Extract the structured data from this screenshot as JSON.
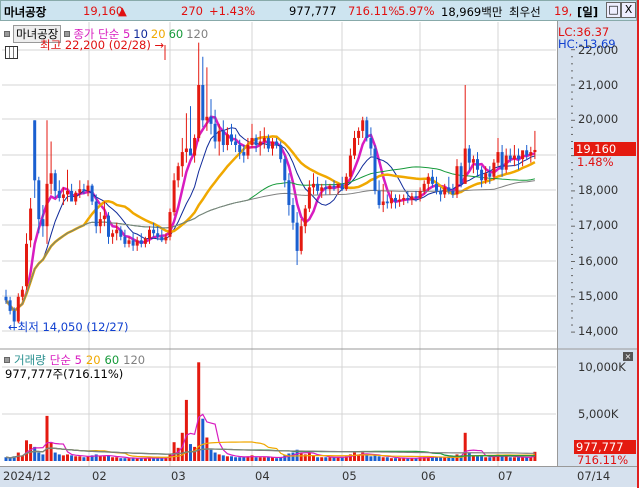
{
  "header": {
    "name": "마녀공장",
    "price": "19,160",
    "arrow": "▲",
    "change": "270",
    "change_pct": "+1.43%",
    "volume": "977,777",
    "volume_ratio": "716.11%",
    "turnover": "5.97%",
    "amount": "18,969백만",
    "best_label": "최우선",
    "best_price": "19,",
    "period": "[일]",
    "restore": "□",
    "close": "X"
  },
  "legend": {
    "stock_button": "마녀공장",
    "ma_label": "종가 단순 5",
    "ma10": "10",
    "ma20": "20",
    "ma60": "60",
    "ma120": "120"
  },
  "volume_legend": {
    "label": "거래량",
    "simple": "단순 5",
    "ma20": "20",
    "ma60": "60",
    "ma120": "120",
    "readout": "977,777주(716.11%)"
  },
  "annotations": {
    "high": "최고 22,200 (02/28)",
    "high_arrow": "→",
    "low": "최저 14,050 (12/27)",
    "low_arrow": "←"
  },
  "axis": {
    "lc": "LC:36.37",
    "hc": "HC:-13.69",
    "price_ticks": [
      "22,000",
      "21,000",
      "20,000",
      "18,000",
      "17,000",
      "16,000",
      "15,000",
      "14,000"
    ],
    "current_price": "19,160",
    "current_pct": "1.48%",
    "volume_ticks": [
      "10,000K",
      "5,000K"
    ],
    "current_volume": "977,777",
    "current_volume_pct": "716.11%"
  },
  "dates": [
    "2024/12",
    "02",
    "03",
    "04",
    "05",
    "06",
    "07",
    "07/14"
  ],
  "colors": {
    "up": "#e41a10",
    "down": "#1a5fd0",
    "ma5": "#d81cc0",
    "ma10": "#102a9a",
    "ma20": "#f0a800",
    "ma60": "#169a3a",
    "ma120": "#808080"
  },
  "chart_data": {
    "type": "candlestick",
    "price_range": [
      13700,
      22300
    ],
    "volume_range_k": [
      0,
      10500
    ],
    "ma_periods": [
      5,
      10,
      20,
      60,
      120
    ],
    "ohlcv": [
      [
        15000,
        15200,
        14800,
        14900,
        400
      ],
      [
        14900,
        15000,
        14500,
        14600,
        300
      ],
      [
        14600,
        14700,
        14050,
        14300,
        500
      ],
      [
        14300,
        15100,
        14250,
        15000,
        900
      ],
      [
        15000,
        15300,
        14900,
        15200,
        600
      ],
      [
        15300,
        16800,
        15200,
        16500,
        2200
      ],
      [
        16600,
        17800,
        16400,
        17500,
        1800
      ],
      [
        20000,
        20000,
        17800,
        18300,
        1500
      ],
      [
        18300,
        18400,
        16800,
        17200,
        900
      ],
      [
        17200,
        17600,
        16700,
        17000,
        700
      ],
      [
        17000,
        20000,
        16500,
        18200,
        4800
      ],
      [
        18200,
        19400,
        17900,
        18500,
        2000
      ],
      [
        18500,
        18600,
        17800,
        18000,
        900
      ],
      [
        18000,
        18300,
        17700,
        17800,
        700
      ],
      [
        17800,
        18100,
        17600,
        17900,
        600
      ],
      [
        17900,
        18600,
        17700,
        18000,
        700
      ],
      [
        18000,
        18200,
        17700,
        17700,
        600
      ],
      [
        17700,
        18000,
        17600,
        17950,
        500
      ],
      [
        17950,
        18300,
        17800,
        18050,
        500
      ],
      [
        18050,
        18200,
        17900,
        18000,
        400
      ],
      [
        18000,
        18300,
        17850,
        18150,
        500
      ],
      [
        18150,
        18200,
        17600,
        17700,
        600
      ],
      [
        17700,
        17900,
        16800,
        17000,
        700
      ],
      [
        17000,
        17400,
        16800,
        17200,
        500
      ],
      [
        17200,
        17700,
        17000,
        17300,
        500
      ],
      [
        17300,
        17400,
        16500,
        16700,
        600
      ],
      [
        16700,
        16900,
        16500,
        16800,
        400
      ],
      [
        16800,
        17100,
        16600,
        16900,
        400
      ],
      [
        16900,
        17000,
        16600,
        16700,
        300
      ],
      [
        16700,
        16900,
        16400,
        16500,
        300
      ],
      [
        16500,
        16700,
        16400,
        16600,
        300
      ],
      [
        16600,
        16800,
        16300,
        16450,
        300
      ],
      [
        16450,
        16700,
        16300,
        16600,
        300
      ],
      [
        16600,
        16800,
        16400,
        16500,
        300
      ],
      [
        16500,
        16700,
        16400,
        16650,
        300
      ],
      [
        16650,
        17000,
        16500,
        16900,
        400
      ],
      [
        16900,
        17100,
        16700,
        16800,
        300
      ],
      [
        16800,
        17000,
        16600,
        16700,
        300
      ],
      [
        16700,
        16900,
        16550,
        16600,
        300
      ],
      [
        16600,
        16800,
        16500,
        16700,
        300
      ],
      [
        16700,
        17500,
        16600,
        17400,
        800
      ],
      [
        17400,
        18500,
        17300,
        18300,
        2000
      ],
      [
        18300,
        18800,
        18100,
        18700,
        1400
      ],
      [
        18700,
        19500,
        18400,
        19100,
        3000
      ],
      [
        19100,
        20200,
        18800,
        19200,
        6500
      ],
      [
        19200,
        20400,
        19100,
        19000,
        1800
      ],
      [
        19000,
        19600,
        18800,
        19500,
        1500
      ],
      [
        19500,
        22200,
        19400,
        21000,
        10500
      ],
      [
        21000,
        21800,
        19800,
        20000,
        4500
      ],
      [
        20000,
        21500,
        19700,
        20100,
        2500
      ],
      [
        20100,
        20600,
        19600,
        19900,
        1200
      ],
      [
        19900,
        20300,
        19200,
        19400,
        900
      ],
      [
        19400,
        19900,
        19000,
        19700,
        700
      ],
      [
        19700,
        20000,
        19100,
        19300,
        600
      ],
      [
        19300,
        19800,
        19150,
        19600,
        500
      ],
      [
        19600,
        19900,
        19300,
        19400,
        500
      ],
      [
        19400,
        19600,
        19100,
        19300,
        400
      ],
      [
        19300,
        19450,
        18900,
        19100,
        400
      ],
      [
        19100,
        19300,
        18800,
        19000,
        400
      ],
      [
        19000,
        19500,
        18900,
        19300,
        500
      ],
      [
        19300,
        19900,
        19200,
        19500,
        600
      ],
      [
        19500,
        19600,
        19100,
        19300,
        400
      ],
      [
        19300,
        19700,
        19000,
        19400,
        400
      ],
      [
        19400,
        19800,
        19200,
        19500,
        400
      ],
      [
        19500,
        19600,
        19100,
        19200,
        400
      ],
      [
        19200,
        19500,
        19000,
        19400,
        400
      ],
      [
        19400,
        19500,
        19200,
        19300,
        300
      ],
      [
        19300,
        19400,
        18800,
        18900,
        400
      ],
      [
        18900,
        19000,
        18100,
        18300,
        600
      ],
      [
        18300,
        18500,
        17300,
        17600,
        800
      ],
      [
        17600,
        17800,
        16900,
        17100,
        900
      ],
      [
        17100,
        17400,
        15900,
        16300,
        1200
      ],
      [
        16300,
        17200,
        16200,
        17000,
        800
      ],
      [
        17000,
        17600,
        16800,
        17500,
        700
      ],
      [
        17500,
        18300,
        17400,
        18100,
        900
      ],
      [
        18100,
        18500,
        17900,
        18200,
        600
      ],
      [
        18200,
        18400,
        17900,
        18000,
        400
      ],
      [
        18000,
        18200,
        17800,
        18100,
        400
      ],
      [
        18100,
        18300,
        17900,
        18050,
        400
      ],
      [
        18050,
        18200,
        17900,
        18150,
        400
      ],
      [
        18150,
        18300,
        18000,
        18100,
        400
      ],
      [
        18100,
        18200,
        17900,
        18200,
        400
      ],
      [
        18200,
        18400,
        18000,
        18050,
        400
      ],
      [
        18050,
        18500,
        18000,
        18400,
        500
      ],
      [
        18400,
        19200,
        18300,
        19000,
        700
      ],
      [
        19000,
        19700,
        18900,
        19500,
        900
      ],
      [
        19500,
        19800,
        19300,
        19700,
        700
      ],
      [
        19700,
        20100,
        19500,
        20000,
        900
      ],
      [
        20000,
        20100,
        19400,
        19500,
        600
      ],
      [
        19500,
        19800,
        19000,
        19200,
        500
      ],
      [
        19200,
        19300,
        17900,
        18000,
        700
      ],
      [
        18000,
        18300,
        17500,
        17600,
        500
      ],
      [
        17600,
        18200,
        17400,
        17700,
        400
      ],
      [
        17700,
        17900,
        17500,
        17650,
        400
      ],
      [
        17650,
        18000,
        17500,
        17800,
        300
      ],
      [
        17800,
        17900,
        17500,
        17700,
        300
      ],
      [
        17700,
        17900,
        17550,
        17750,
        300
      ],
      [
        17750,
        17900,
        17600,
        17800,
        300
      ],
      [
        17800,
        18000,
        17650,
        17750,
        300
      ],
      [
        17750,
        17950,
        17600,
        17850,
        300
      ],
      [
        17850,
        18000,
        17700,
        17800,
        300
      ],
      [
        17800,
        18100,
        17700,
        18000,
        400
      ],
      [
        18000,
        18300,
        17900,
        18200,
        400
      ],
      [
        18200,
        18500,
        18000,
        18400,
        400
      ],
      [
        18400,
        18600,
        18100,
        18200,
        500
      ],
      [
        18200,
        18400,
        17900,
        18000,
        400
      ],
      [
        18000,
        18100,
        17700,
        17900,
        400
      ],
      [
        17900,
        18200,
        17800,
        18100,
        400
      ],
      [
        18100,
        18400,
        17900,
        18000,
        400
      ],
      [
        18000,
        18200,
        17800,
        17900,
        400
      ],
      [
        17900,
        18900,
        17800,
        18700,
        700
      ],
      [
        18700,
        18800,
        18100,
        18200,
        600
      ],
      [
        18200,
        21000,
        18200,
        19200,
        3000
      ],
      [
        19200,
        19300,
        18600,
        18800,
        900
      ],
      [
        18800,
        19000,
        18500,
        18900,
        600
      ],
      [
        18900,
        19100,
        18400,
        18600,
        500
      ],
      [
        18600,
        18700,
        18100,
        18300,
        500
      ],
      [
        18300,
        18700,
        18200,
        18500,
        400
      ],
      [
        18500,
        18700,
        18200,
        18400,
        400
      ],
      [
        18400,
        18900,
        18300,
        18800,
        500
      ],
      [
        18800,
        19500,
        18700,
        19100,
        700
      ],
      [
        19100,
        19300,
        18400,
        18600,
        500
      ],
      [
        18600,
        19200,
        18500,
        19000,
        500
      ],
      [
        19000,
        19200,
        18800,
        18900,
        400
      ],
      [
        18900,
        19300,
        18700,
        19000,
        400
      ],
      [
        19000,
        19200,
        18600,
        18900,
        400
      ],
      [
        18900,
        19100,
        18700,
        19150,
        400
      ],
      [
        19150,
        19300,
        18900,
        19000,
        400
      ],
      [
        19000,
        19250,
        18800,
        19100,
        400
      ],
      [
        19100,
        19700,
        18900,
        19160,
        977.777
      ]
    ]
  }
}
